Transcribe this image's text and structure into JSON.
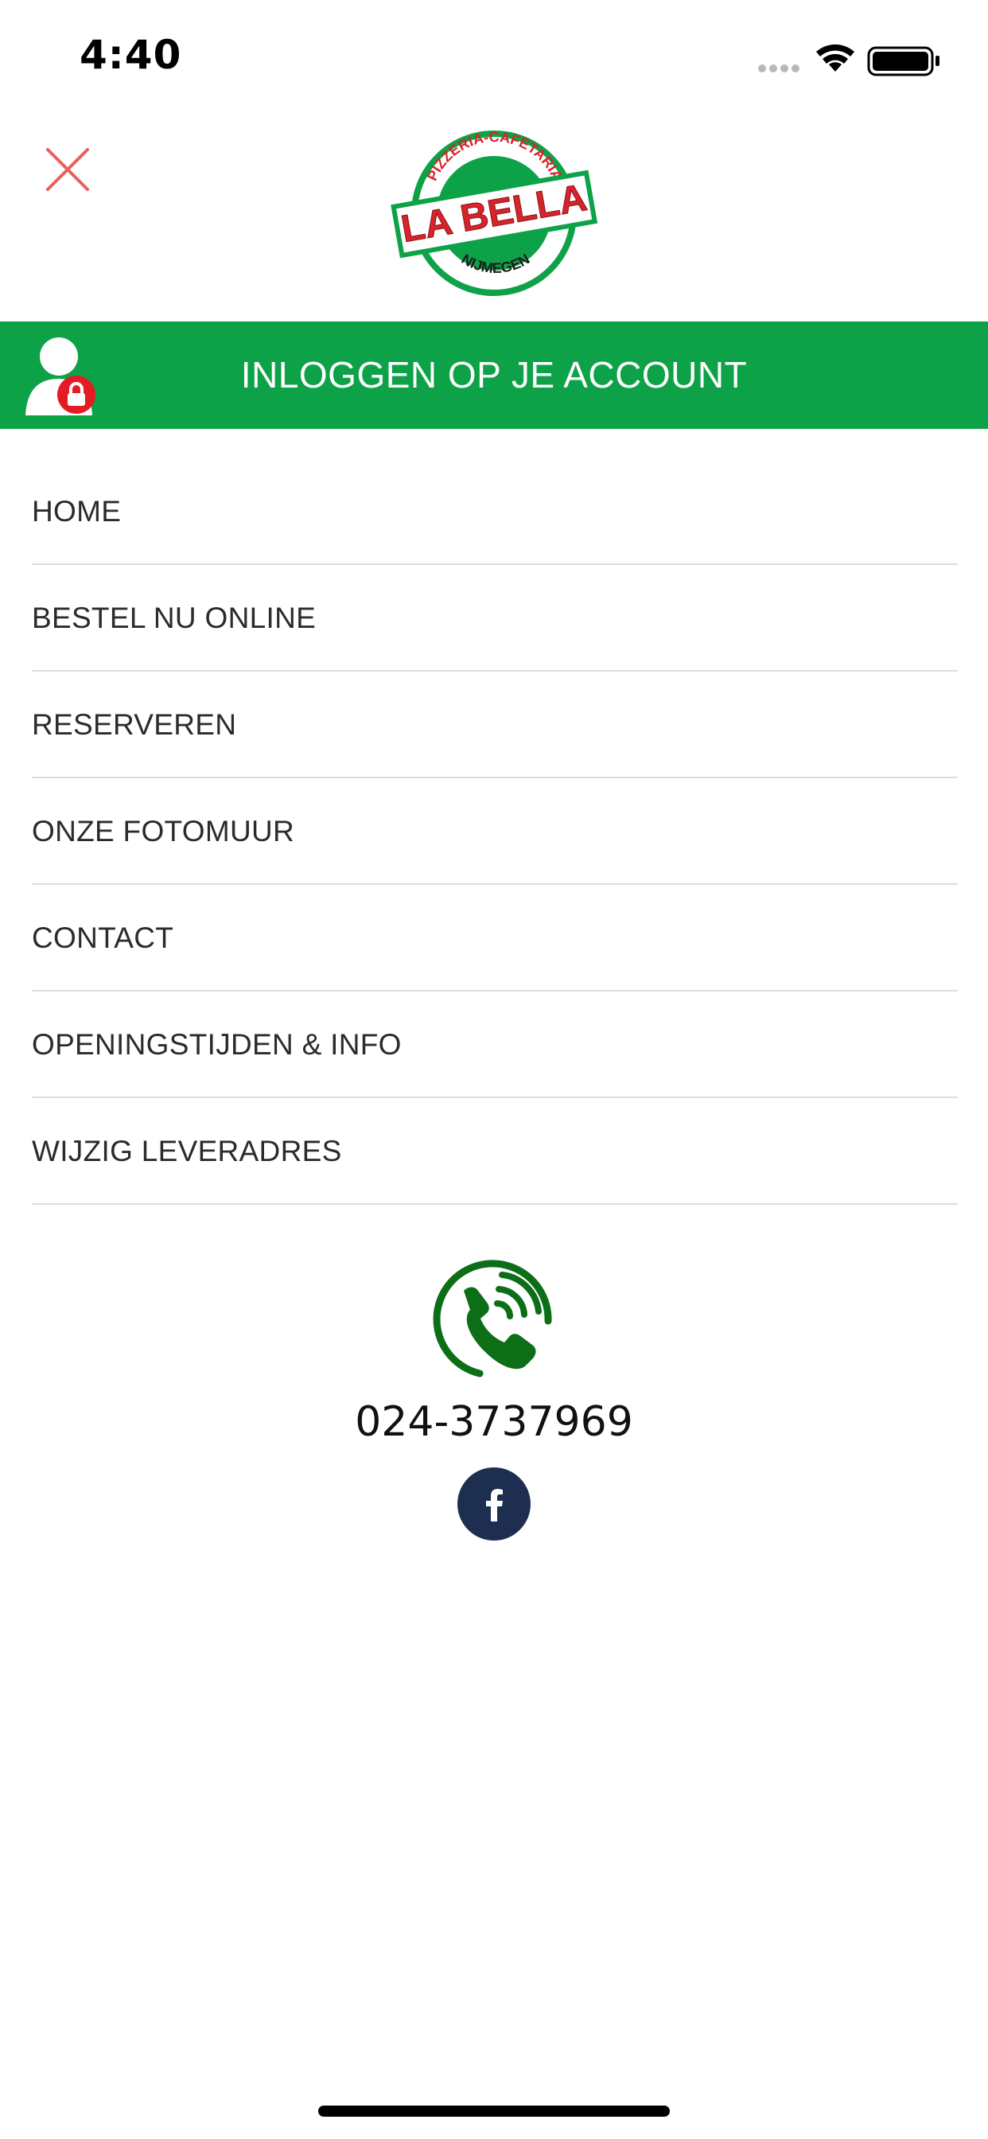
{
  "status_bar": {
    "time": "4:40",
    "icons": [
      "signal-dots-icon",
      "wifi-icon",
      "battery-icon"
    ]
  },
  "header": {
    "close_icon": "close-icon",
    "logo": {
      "top_text": "PIZZERIA-CAFETARIA",
      "main_text": "LA BELLA",
      "bottom_text": "NIJMEGEN"
    }
  },
  "login": {
    "label": "INLOGGEN OP JE ACCOUNT",
    "icon": "user-lock-icon"
  },
  "menu": {
    "items": [
      {
        "label": "HOME"
      },
      {
        "label": "BESTEL NU ONLINE"
      },
      {
        "label": "RESERVEREN"
      },
      {
        "label": "ONZE FOTOMUUR"
      },
      {
        "label": "CONTACT"
      },
      {
        "label": "OPENINGSTIJDEN & INFO"
      },
      {
        "label": "WIJZIG LEVERADRES"
      }
    ]
  },
  "contact": {
    "phone": "024-3737969",
    "phone_icon": "phone-ring-icon",
    "social_icon": "facebook-icon"
  },
  "colors": {
    "brand_green": "#0ea248",
    "phone_green": "#0c6e16",
    "close_red": "#e8615a",
    "facebook_navy": "#1e2e50",
    "logo_red": "#d6242b"
  }
}
